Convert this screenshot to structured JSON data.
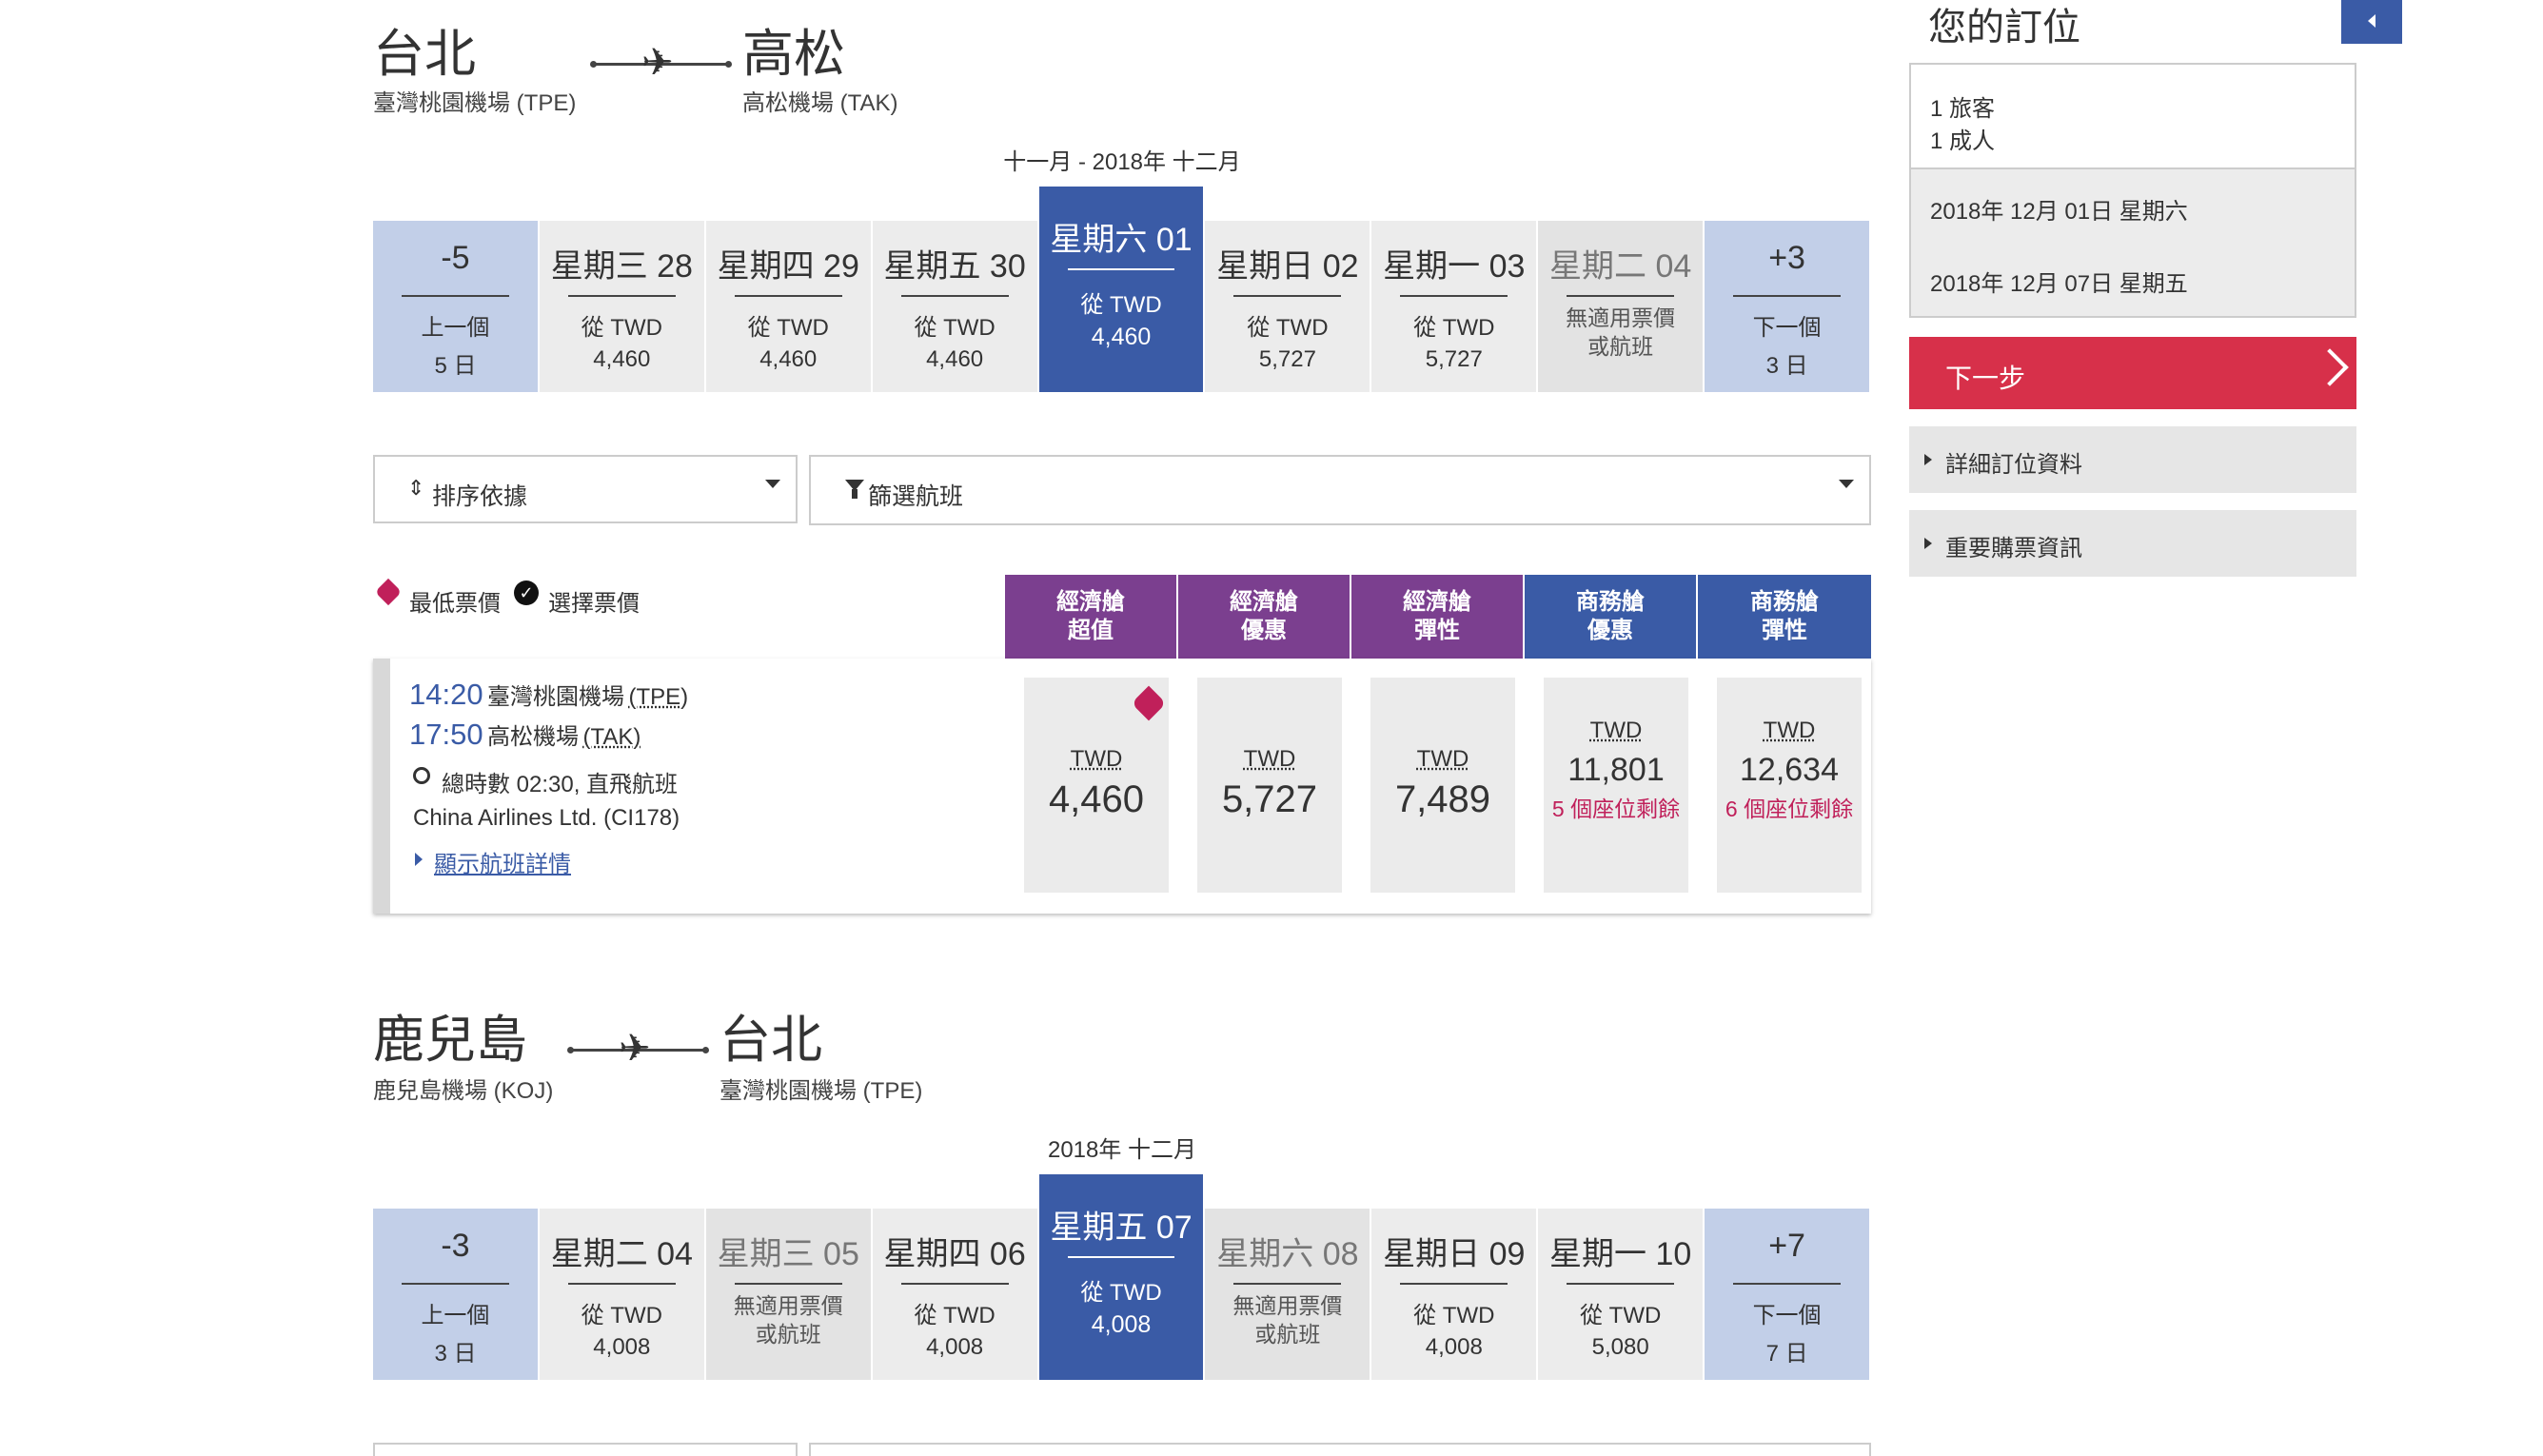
{
  "outbound": {
    "from_city": "台北",
    "from_airport": "臺灣桃園機場 (TPE)",
    "to_city": "高松",
    "to_airport": "高松機場 (TAK)",
    "month_label": "十一月 - 2018年 十二月",
    "dates": [
      {
        "day": "-5",
        "l1": "上一個",
        "l2": "5 日",
        "kind": "nav"
      },
      {
        "day": "星期三 28",
        "l1": "從 TWD",
        "l2": "4,460",
        "kind": "avail"
      },
      {
        "day": "星期四 29",
        "l1": "從 TWD",
        "l2": "4,460",
        "kind": "avail"
      },
      {
        "day": "星期五 30",
        "l1": "從 TWD",
        "l2": "4,460",
        "kind": "avail"
      },
      {
        "day": "星期六 01",
        "l1": "從 TWD",
        "l2": "4,460",
        "kind": "sel"
      },
      {
        "day": "星期日 02",
        "l1": "從 TWD",
        "l2": "5,727",
        "kind": "avail"
      },
      {
        "day": "星期一 03",
        "l1": "從 TWD",
        "l2": "5,727",
        "kind": "avail"
      },
      {
        "day": "星期二 04",
        "l1": "無適用票價",
        "l2": "或航班",
        "kind": "na"
      },
      {
        "day": "+3",
        "l1": "下一個",
        "l2": "3 日",
        "kind": "nav"
      }
    ]
  },
  "controls": {
    "sort_label": "排序依據",
    "filter_label": "篩選航班"
  },
  "legend": {
    "lowest": "最低票價",
    "selected": "選擇票價"
  },
  "cabins": [
    {
      "l1": "經濟艙",
      "l2": "超值"
    },
    {
      "l1": "經濟艙",
      "l2": "優惠"
    },
    {
      "l1": "經濟艙",
      "l2": "彈性"
    },
    {
      "l1": "商務艙",
      "l2": "優惠"
    },
    {
      "l1": "商務艙",
      "l2": "彈性"
    }
  ],
  "flight": {
    "dep_time": "14:20",
    "dep_airport": "臺灣桃園機場",
    "dep_code": "(TPE)",
    "arr_time": "17:50",
    "arr_airport": "高松機場",
    "arr_code": "(TAK)",
    "duration": "總時數 02:30, 直飛航班",
    "carrier": "China Airlines Ltd. (CI178)",
    "details_link": "顯示航班詳情",
    "fares": [
      {
        "cur": "TWD",
        "amt": "4,460",
        "seats": ""
      },
      {
        "cur": "TWD",
        "amt": "5,727",
        "seats": ""
      },
      {
        "cur": "TWD",
        "amt": "7,489",
        "seats": ""
      },
      {
        "cur": "TWD",
        "amt": "11,801",
        "seats": "5 個座位剩餘"
      },
      {
        "cur": "TWD",
        "amt": "12,634",
        "seats": "6 個座位剩餘"
      }
    ]
  },
  "inbound": {
    "from_city": "鹿兒島",
    "from_airport": "鹿兒島機場 (KOJ)",
    "to_city": "台北",
    "to_airport": "臺灣桃園機場 (TPE)",
    "month_label": "2018年 十二月",
    "dates": [
      {
        "day": "-3",
        "l1": "上一個",
        "l2": "3 日",
        "kind": "nav"
      },
      {
        "day": "星期二 04",
        "l1": "從 TWD",
        "l2": "4,008",
        "kind": "avail"
      },
      {
        "day": "星期三 05",
        "l1": "無適用票價",
        "l2": "或航班",
        "kind": "na"
      },
      {
        "day": "星期四 06",
        "l1": "從 TWD",
        "l2": "4,008",
        "kind": "avail"
      },
      {
        "day": "星期五 07",
        "l1": "從 TWD",
        "l2": "4,008",
        "kind": "sel"
      },
      {
        "day": "星期六 08",
        "l1": "無適用票價",
        "l2": "或航班",
        "kind": "na"
      },
      {
        "day": "星期日 09",
        "l1": "從 TWD",
        "l2": "4,008",
        "kind": "avail"
      },
      {
        "day": "星期一 10",
        "l1": "從 TWD",
        "l2": "5,080",
        "kind": "avail"
      },
      {
        "day": "+7",
        "l1": "下一個",
        "l2": "7 日",
        "kind": "nav"
      }
    ]
  },
  "sidebar": {
    "title": "您的訂位",
    "travelers": "1 旅客",
    "adults": "1 成人",
    "date_out": "2018年 12月 01日 星期六",
    "date_in": "2018年 12月 07日 星期五",
    "next_label": "下一步",
    "details_label": "詳細訂位資料",
    "info_label": "重要購票資訊"
  },
  "colors": {
    "accent_blue": "#3a5ba6",
    "nav_blue": "#c2cfe8",
    "economy_purple": "#7b3f8f",
    "next_red": "#d7304a",
    "seats_red": "#c0205a"
  }
}
